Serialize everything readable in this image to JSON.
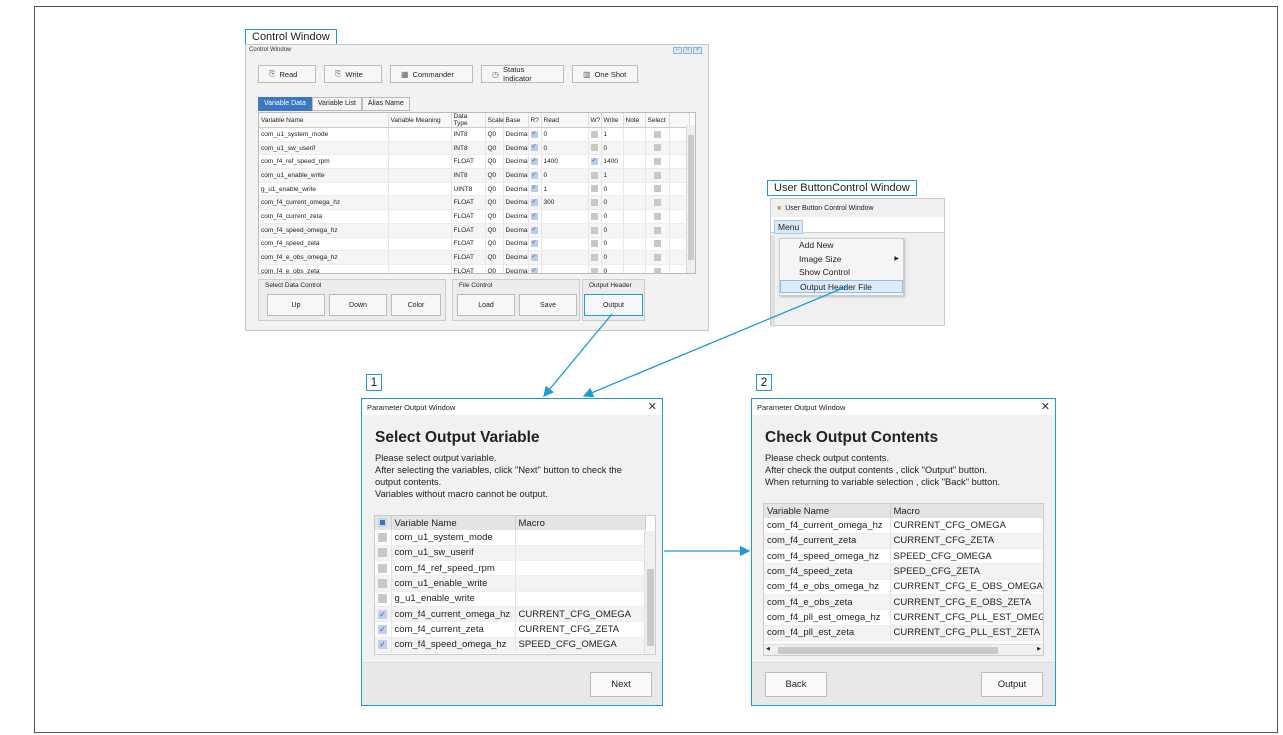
{
  "callouts": {
    "control_window": "Control Window",
    "user_button_window": "User ButtonControl Window",
    "step1": "1",
    "step2": "2"
  },
  "control_window": {
    "title": "Control Window",
    "toolbar": {
      "read": "Read",
      "write": "Write",
      "commander": "Commander",
      "status_indicator": "Status Indicator",
      "one_shot": "One Shot"
    },
    "tabs": [
      "Variable Data",
      "Variable List",
      "Alias Name"
    ],
    "columns": [
      "Variable Name",
      "Variable Meaning",
      "Data Type",
      "Scale",
      "Base",
      "R?",
      "Read",
      "W?",
      "Write",
      "Note",
      "Select"
    ],
    "rows": [
      {
        "name": "com_u1_system_mode",
        "type": "INT8",
        "scale": "Q0",
        "base": "Decimal",
        "r": true,
        "read": "0",
        "w": false,
        "write": "1"
      },
      {
        "name": "com_u1_sw_userif",
        "type": "INT8",
        "scale": "Q0",
        "base": "Decimal",
        "r": true,
        "read": "0",
        "w": false,
        "write": "0"
      },
      {
        "name": "com_f4_ref_speed_rpm",
        "type": "FLOAT",
        "scale": "Q0",
        "base": "Decimal",
        "r": true,
        "read": "1400",
        "w": true,
        "write": "1400"
      },
      {
        "name": "com_u1_enable_write",
        "type": "INT8",
        "scale": "Q0",
        "base": "Decimal",
        "r": true,
        "read": "0",
        "w": false,
        "write": "1"
      },
      {
        "name": "g_u1_enable_write",
        "type": "UINT8",
        "scale": "Q0",
        "base": "Decimal",
        "r": true,
        "read": "1",
        "w": false,
        "write": "0"
      },
      {
        "name": "com_f4_current_omega_hz",
        "type": "FLOAT",
        "scale": "Q0",
        "base": "Decimal",
        "r": true,
        "read": "300",
        "w": false,
        "write": "0"
      },
      {
        "name": "com_f4_current_zeta",
        "type": "FLOAT",
        "scale": "Q0",
        "base": "Decimal",
        "r": true,
        "read": "",
        "w": false,
        "write": "0"
      },
      {
        "name": "com_f4_speed_omega_hz",
        "type": "FLOAT",
        "scale": "Q0",
        "base": "Decimal",
        "r": true,
        "read": "",
        "w": false,
        "write": "0"
      },
      {
        "name": "com_f4_speed_zeta",
        "type": "FLOAT",
        "scale": "Q0",
        "base": "Decimal",
        "r": true,
        "read": "",
        "w": false,
        "write": "0"
      },
      {
        "name": "com_f4_e_obs_omega_hz",
        "type": "FLOAT",
        "scale": "Q0",
        "base": "Decimal",
        "r": true,
        "read": "",
        "w": false,
        "write": "0"
      },
      {
        "name": "com_f4_e_obs_zeta",
        "type": "FLOAT",
        "scale": "Q0",
        "base": "Decimal",
        "r": true,
        "read": "",
        "w": false,
        "write": "0"
      }
    ],
    "groups": {
      "select_data_control": {
        "label": "Select Data Control",
        "up": "Up",
        "down": "Down",
        "color": "Color"
      },
      "file_control": {
        "label": "File Control",
        "load": "Load",
        "save": "Save"
      },
      "output_header": {
        "label": "Output Header",
        "output": "Output"
      }
    }
  },
  "user_button_window": {
    "title": "User Button Control Window",
    "menu": "Menu",
    "items": [
      "Add New",
      "Image Size",
      "Show Control",
      "Output Header File"
    ]
  },
  "select_window": {
    "title": "Parameter Output Window",
    "heading": "Select Output Variable",
    "desc": [
      "Please select output variable.",
      "After selecting the variables, click \"Next\" button to check the",
      "output contents.",
      "Variables without macro cannot be output."
    ],
    "columns": [
      "Variable Name",
      "Macro"
    ],
    "rows": [
      {
        "name": "com_u1_system_mode",
        "macro": "",
        "checked": false
      },
      {
        "name": "com_u1_sw_userif",
        "macro": "",
        "checked": false
      },
      {
        "name": "com_f4_ref_speed_rpm",
        "macro": "",
        "checked": false
      },
      {
        "name": "com_u1_enable_write",
        "macro": "",
        "checked": false
      },
      {
        "name": "g_u1_enable_write",
        "macro": "",
        "checked": false
      },
      {
        "name": "com_f4_current_omega_hz",
        "macro": "CURRENT_CFG_OMEGA",
        "checked": true
      },
      {
        "name": "com_f4_current_zeta",
        "macro": "CURRENT_CFG_ZETA",
        "checked": true
      },
      {
        "name": "com_f4_speed_omega_hz",
        "macro": "SPEED_CFG_OMEGA",
        "checked": true
      }
    ],
    "next": "Next"
  },
  "check_window": {
    "title": "Parameter Output Window",
    "heading": "Check Output Contents",
    "desc": [
      "Please check output contents.",
      "After check the output contents , click \"Output\" button.",
      "When returning to variable selection , click \"Back\" button."
    ],
    "columns": [
      "Variable Name",
      "Macro"
    ],
    "rows": [
      {
        "name": "com_f4_current_omega_hz",
        "macro": "CURRENT_CFG_OMEGA"
      },
      {
        "name": "com_f4_current_zeta",
        "macro": "CURRENT_CFG_ZETA"
      },
      {
        "name": "com_f4_speed_omega_hz",
        "macro": "SPEED_CFG_OMEGA"
      },
      {
        "name": "com_f4_speed_zeta",
        "macro": "SPEED_CFG_ZETA"
      },
      {
        "name": "com_f4_e_obs_omega_hz",
        "macro": "CURRENT_CFG_E_OBS_OMEGA"
      },
      {
        "name": "com_f4_e_obs_zeta",
        "macro": "CURRENT_CFG_E_OBS_ZETA"
      },
      {
        "name": "com_f4_pll_est_omega_hz",
        "macro": "CURRENT_CFG_PLL_EST_OMEGA"
      },
      {
        "name": "com_f4_pll_est_zeta",
        "macro": "CURRENT_CFG_PLL_EST_ZETA"
      }
    ],
    "back": "Back",
    "output": "Output"
  },
  "colors": {
    "accent": "#1e9ad6",
    "tab_active": "#3a78c2"
  }
}
